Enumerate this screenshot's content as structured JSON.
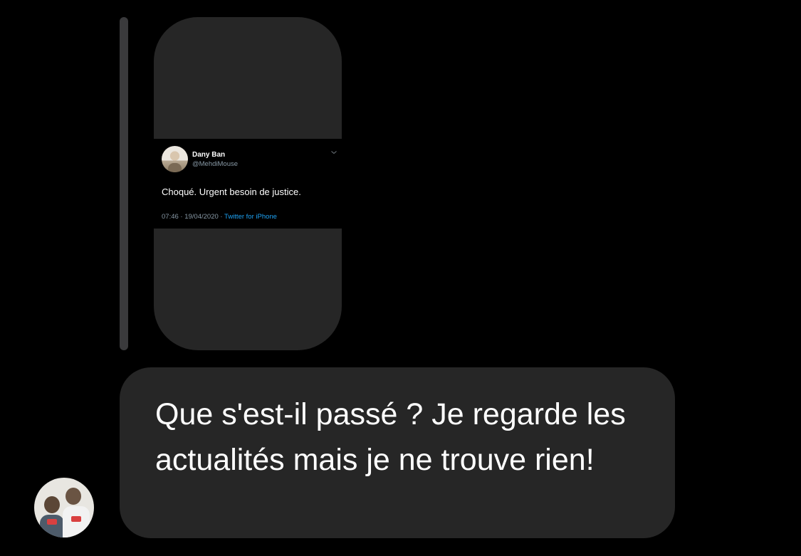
{
  "shared_tweet": {
    "author_name": "Dany Ban",
    "author_handle": "@MehdiMouse",
    "text": "Choqué. Urgent besoin de justice.",
    "timestamp": "07:46 · 19/04/2020 · ",
    "source": "Twitter for iPhone",
    "source_color": "#1da1f2"
  },
  "message": {
    "text": "Que s'est-il passé ? Je regarde les actualités mais je ne trouve rien!"
  },
  "icons": {
    "tweet_menu": "chevron-down-icon",
    "sender": "avatar"
  }
}
